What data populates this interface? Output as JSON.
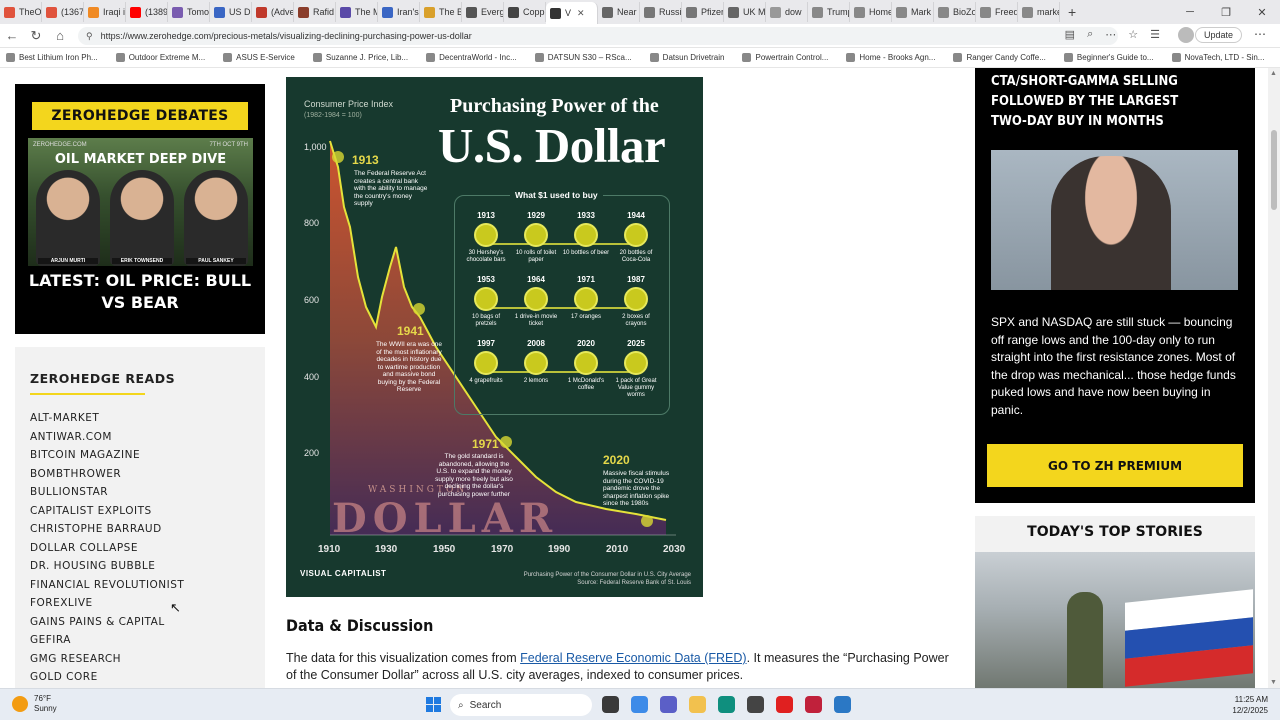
{
  "tabs": [
    {
      "label": "TheO",
      "color": "#e0533d"
    },
    {
      "label": "(1367",
      "color": "#e0533d"
    },
    {
      "label": "Iraqi i",
      "color": "#f08a24"
    },
    {
      "label": "(1389",
      "color": "#ff0000"
    },
    {
      "label": "Tomo",
      "color": "#7a5cb0"
    },
    {
      "label": "US D",
      "color": "#3a66c4"
    },
    {
      "label": "(Adve",
      "color": "#c0392b"
    },
    {
      "label": "Rafid",
      "color": "#8a3d2b"
    },
    {
      "label": "The M",
      "color": "#5a4aa8"
    },
    {
      "label": "Iran's",
      "color": "#3a66c4"
    },
    {
      "label": "The B",
      "color": "#d9a02b"
    },
    {
      "label": "Everg",
      "color": "#555555"
    },
    {
      "label": "Copp",
      "color": "#444444"
    },
    {
      "label": "V",
      "color": "#333333"
    },
    {
      "label": "Near",
      "color": "#666666"
    },
    {
      "label": "Russi",
      "color": "#777777"
    },
    {
      "label": "Pfizer",
      "color": "#777777"
    },
    {
      "label": "UK M",
      "color": "#666666"
    },
    {
      "label": "dow",
      "color": "#999999"
    },
    {
      "label": "Trump",
      "color": "#888888"
    },
    {
      "label": "Home",
      "color": "#888888"
    },
    {
      "label": "Mark",
      "color": "#888888"
    },
    {
      "label": "BioZo",
      "color": "#888888"
    },
    {
      "label": "Freed",
      "color": "#888888"
    },
    {
      "label": "marke",
      "color": "#888888"
    }
  ],
  "url": "https://www.zerohedge.com/precious-metals/visualizing-declining-purchasing-power-us-dollar",
  "update_label": "Update",
  "bookmarks": [
    "Best Lithium Iron Ph...",
    "Outdoor Extreme M...",
    "ASUS E-Service",
    "Suzanne J. Price, Lib...",
    "DecentraWorld - Inc...",
    "DATSUN S30 – RSca...",
    "Datsun Drivetrain",
    "Powertrain Control...",
    "Home - Brooks Agn...",
    "Ranger Candy Coffe...",
    "Beginner's Guide to...",
    "NovaTech, LTD - Sin..."
  ],
  "debates": {
    "heading": "ZEROHEDGE DEBATES",
    "image_site": "ZEROHEDGE.COM",
    "image_date": "7TH OCT 9TH",
    "image_title": "OIL MARKET DEEP DIVE",
    "speakers": [
      "ARJUN MURTI",
      "ERIK TOWNSEND",
      "PAUL SANKEY"
    ],
    "caption": "LATEST: OIL PRICE: BULL VS BEAR"
  },
  "reads": {
    "heading": "ZEROHEDGE READS",
    "items": [
      "ALT-MARKET",
      "ANTIWAR.COM",
      "BITCOIN MAGAZINE",
      "BOMBTHROWER",
      "BULLIONSTAR",
      "CAPITALIST EXPLOITS",
      "CHRISTOPHE BARRAUD",
      "DOLLAR COLLAPSE",
      "DR. HOUSING BUBBLE",
      "FINANCIAL REVOLUTIONIST",
      "FOREXLIVE",
      "GAINS PAINS & CAPITAL",
      "GEFIRA",
      "GMG RESEARCH",
      "GOLD CORE"
    ]
  },
  "infographic": {
    "cpi_label": "Consumer Price Index",
    "cpi_sub": "(1982-1984 = 100)",
    "title_top": "Purchasing Power of the",
    "title_big": "U.S. Dollar",
    "y_ticks": [
      "1,000",
      "800",
      "600",
      "400",
      "200"
    ],
    "x_ticks": [
      "1910",
      "1930",
      "1950",
      "1970",
      "1990",
      "2010",
      "2030"
    ],
    "annotations": [
      {
        "year": "1913",
        "text": "The Federal Reserve Act creates a central bank with the ability to manage the country's money supply"
      },
      {
        "year": "1941",
        "text": "The WWII era was one of the most inflationary decades in history due to wartime production and massive bond buying by the Federal Reserve"
      },
      {
        "year": "1971",
        "text": "The gold standard is abandoned, allowing the U.S. to expand the money supply more freely but also declining the dollar's purchasing power further"
      },
      {
        "year": "2020",
        "text": "Massive fiscal stimulus during the COVID-19 pandemic drove the sharpest inflation spike since the 1980s"
      }
    ],
    "box_title": "What $1 used to buy",
    "items": [
      {
        "year": "1913",
        "label": "30 Hershey's chocolate bars"
      },
      {
        "year": "1929",
        "label": "10 rolls of toilet paper"
      },
      {
        "year": "1933",
        "label": "10 bottles of beer"
      },
      {
        "year": "1944",
        "label": "20 bottles of Coca-Cola"
      },
      {
        "year": "1953",
        "label": "10 bags of pretzels"
      },
      {
        "year": "1964",
        "label": "1 drive-in movie ticket"
      },
      {
        "year": "1971",
        "label": "17 oranges"
      },
      {
        "year": "1987",
        "label": "2 boxes of crayons"
      },
      {
        "year": "1997",
        "label": "4 grapefruits"
      },
      {
        "year": "2008",
        "label": "2 lemons"
      },
      {
        "year": "2020",
        "label": "1 McDonald's coffee"
      },
      {
        "year": "2025",
        "label": "1 pack of Great Value gummy worms"
      }
    ],
    "bill_text": "DOLLAR",
    "bill_top": "WASHINGTON",
    "logo": "VISUAL CAPITALIST",
    "source_1": "Purchasing Power of the Consumer Dollar in U.S. City Average",
    "source_2": "Source: Federal Reserve Bank of St. Louis",
    "colors": {
      "bg": "#17392e",
      "accent": "#e5d84a",
      "line": "#d8d832"
    }
  },
  "discussion": {
    "heading": "Data & Discussion",
    "p_before": "The data for this visualization comes from ",
    "link": "Federal Reserve Economic Data (FRED)",
    "p_after": ". It measures the “Purchasing Power of the Consumer Dollar” across all U.S. city averages, indexed to consumer prices."
  },
  "right": {
    "headline": "CTA/SHORT-GAMMA SELLING FOLLOWED BY THE LARGEST TWO-DAY BUY IN MONTHS",
    "body": "SPX and NASDAQ are still stuck — bouncing off range lows and the 100-day only to run straight into the first resistance zones. Most of the drop was mechanical... those hedge funds puked lows and have now been buying in panic.",
    "premium": "GO TO ZH PREMIUM",
    "top_stories": "TODAY'S TOP STORIES"
  },
  "taskbar": {
    "temp": "76°F",
    "weather": "Sunny",
    "search": "Search",
    "time": "11:25 AM",
    "date": "12/2/2025"
  }
}
